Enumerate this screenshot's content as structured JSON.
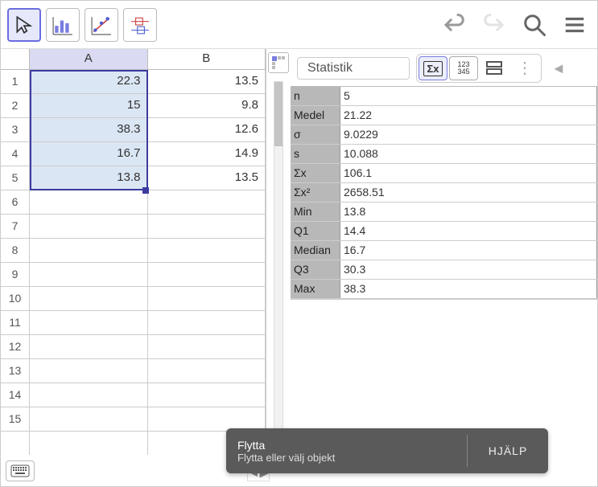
{
  "toolbar": {
    "icons": {
      "move": "move-cursor",
      "bar_chart": "one-var-bar",
      "scatter": "two-var-scatter",
      "boxplot": "boxplot"
    }
  },
  "spreadsheet": {
    "columns": [
      "A",
      "B"
    ],
    "selected_column": "A",
    "selection": "A1:A5",
    "rows_visible": 15,
    "data": {
      "1": {
        "A": "22.3",
        "B": "13.5"
      },
      "2": {
        "A": "15",
        "B": "9.8"
      },
      "3": {
        "A": "38.3",
        "B": "12.6"
      },
      "4": {
        "A": "16.7",
        "B": "14.9"
      },
      "5": {
        "A": "13.8",
        "B": "13.5"
      }
    }
  },
  "right_panel": {
    "title": "Statistik",
    "buttons": {
      "sigma": "Σx",
      "numeric": "123 345"
    }
  },
  "statistics": [
    {
      "label": "n",
      "value": "5"
    },
    {
      "label": "Medel",
      "value": "21.22"
    },
    {
      "label": "σ",
      "value": "9.0229"
    },
    {
      "label": "s",
      "value": "10.088"
    },
    {
      "label": "Σx",
      "value": "106.1"
    },
    {
      "label": "Σx²",
      "value": "2658.51"
    },
    {
      "label": "Min",
      "value": "13.8"
    },
    {
      "label": "Q1",
      "value": "14.4"
    },
    {
      "label": "Median",
      "value": "16.7"
    },
    {
      "label": "Q3",
      "value": "30.3"
    },
    {
      "label": "Max",
      "value": "38.3"
    }
  ],
  "tooltip": {
    "title": "Flytta",
    "subtitle": "Flytta eller välj objekt",
    "help": "HJÄLP"
  }
}
